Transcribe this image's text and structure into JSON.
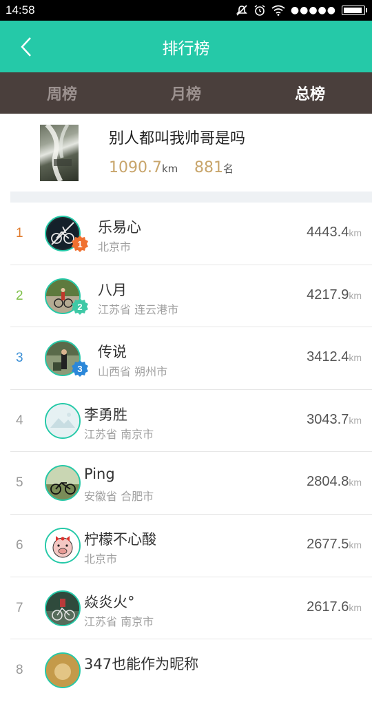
{
  "status_bar": {
    "time": "14:58",
    "signal": "●●●●●",
    "battery_level": 0.95
  },
  "app_bar": {
    "title": "排行榜"
  },
  "tabs": [
    {
      "label": "周榜",
      "active": false
    },
    {
      "label": "月榜",
      "active": false
    },
    {
      "label": "总榜",
      "active": true
    }
  ],
  "me": {
    "name": "别人都叫我帅哥是吗",
    "distance": "1090.7",
    "distance_unit": "km",
    "rank": "881",
    "rank_unit": "名"
  },
  "rankings": [
    {
      "rank": "1",
      "name": "乐易心",
      "city": "北京市",
      "distance": "4443.4",
      "unit": "km",
      "medal": "1"
    },
    {
      "rank": "2",
      "name": "八月",
      "city": "江苏省 连云港市",
      "distance": "4217.9",
      "unit": "km",
      "medal": "2"
    },
    {
      "rank": "3",
      "name": "传说",
      "city": "山西省 朔州市",
      "distance": "3412.4",
      "unit": "km",
      "medal": "3"
    },
    {
      "rank": "4",
      "name": "李勇胜",
      "city": "江苏省 南京市",
      "distance": "3043.7",
      "unit": "km"
    },
    {
      "rank": "5",
      "name": "Ping",
      "city": "安徽省 合肥市",
      "distance": "2804.8",
      "unit": "km"
    },
    {
      "rank": "6",
      "name": "柠檬不心酸",
      "city": "北京市",
      "distance": "2677.5",
      "unit": "km"
    },
    {
      "rank": "7",
      "name": "焱炎火°",
      "city": "江苏省 南京市",
      "distance": "2617.6",
      "unit": "km"
    },
    {
      "rank": "8",
      "name": "347也能作为昵称",
      "city": "",
      "distance": "",
      "unit": ""
    }
  ],
  "colors": {
    "accent": "#25c9a8",
    "tab_bar": "#4a3f3c",
    "rank_1": "#e07b2c",
    "rank_2": "#7cbf45",
    "rank_3": "#3b8fd6",
    "rank_other": "#999999",
    "medal_1": "#f07030",
    "medal_2": "#3ec9a6",
    "medal_3": "#2b87d9",
    "gold_text": "#c8a56b"
  }
}
